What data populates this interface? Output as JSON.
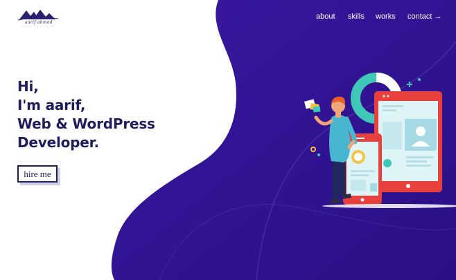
{
  "brand": {
    "logo_text": "aarif ahmed"
  },
  "nav": {
    "items": [
      {
        "label": "about"
      },
      {
        "label": "skills"
      },
      {
        "label": "works"
      },
      {
        "label": "contact →"
      }
    ]
  },
  "hero": {
    "line1": "Hi,",
    "line2": "I'm aarif,",
    "line3": "Web & WordPress",
    "line4": "Developer."
  },
  "cta": {
    "label": "hire me"
  },
  "colors": {
    "primary": "#2b1784",
    "heading": "#1f1d5c",
    "accent_red": "#e8403c",
    "accent_teal": "#3fc8b8",
    "skin": "#f0a678",
    "shirt": "#49b6d0"
  },
  "icons": [
    "logo-mountain-icon",
    "developer-illustration"
  ]
}
